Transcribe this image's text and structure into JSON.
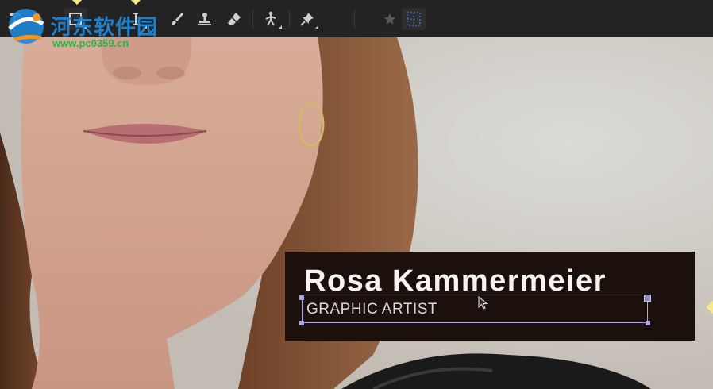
{
  "watermark": {
    "site_name": "河东软件园",
    "url": "www.pc0359.cn"
  },
  "toolbar": {
    "tools": [
      {
        "icon": "text-tool-icon"
      },
      {
        "icon": "transform-tool-icon"
      },
      {
        "icon": "text-cursor-icon"
      },
      {
        "icon": "brush-icon"
      },
      {
        "icon": "clone-stamp-icon"
      },
      {
        "icon": "eraser-icon"
      },
      {
        "icon": "puppet-pin-icon"
      },
      {
        "icon": "roto-pin-icon"
      },
      {
        "icon": "star-icon"
      },
      {
        "icon": "grid-icon"
      }
    ]
  },
  "lower_third": {
    "name": "Rosa Kammermeier",
    "title": "GRAPHIC ARTIST",
    "background": "#1c100c",
    "selection_color": "#a8a6e6"
  },
  "colors": {
    "toolbar": "#232323",
    "keyframe": "#f6e887"
  }
}
